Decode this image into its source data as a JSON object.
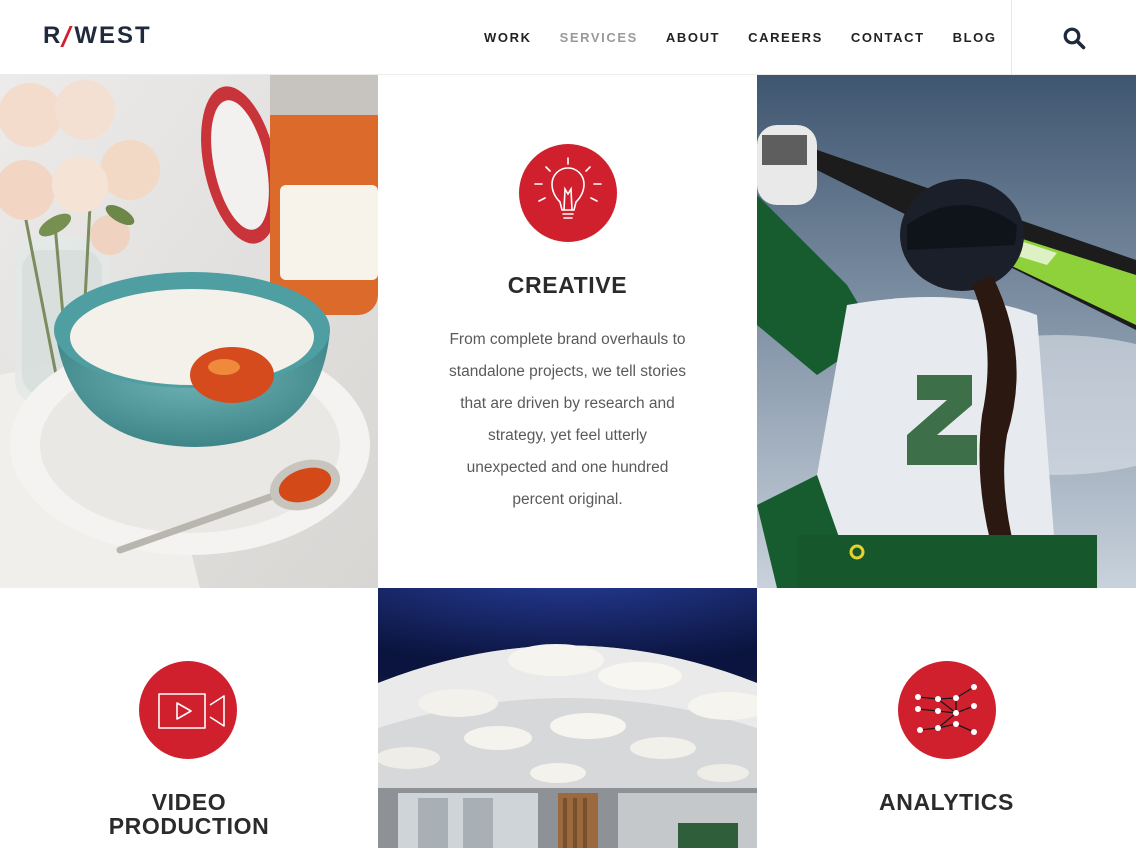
{
  "header": {
    "logo_left": "R",
    "logo_right": "WEST",
    "nav": [
      "WORK",
      "SERVICES",
      "ABOUT",
      "CAREERS",
      "CONTACT",
      "BLOG"
    ],
    "active_nav": "SERVICES",
    "search_icon": "search-icon"
  },
  "services": {
    "creative": {
      "icon": "lightbulb-icon",
      "title": "CREATIVE",
      "description": "From complete brand overhauls to standalone projects, we tell stories that are driven by research and strategy, yet feel utterly unexpected and one hundred percent original."
    },
    "video": {
      "icon": "video-camera-icon",
      "title_line1": "VIDEO",
      "title_line2": "PRODUCTION"
    },
    "analytics": {
      "icon": "network-nodes-icon",
      "title": "ANALYTICS"
    }
  },
  "colors": {
    "brand_red": "#d0202e",
    "logo_navy": "#1f2a3c",
    "nav_active": "#9a9a9a"
  }
}
